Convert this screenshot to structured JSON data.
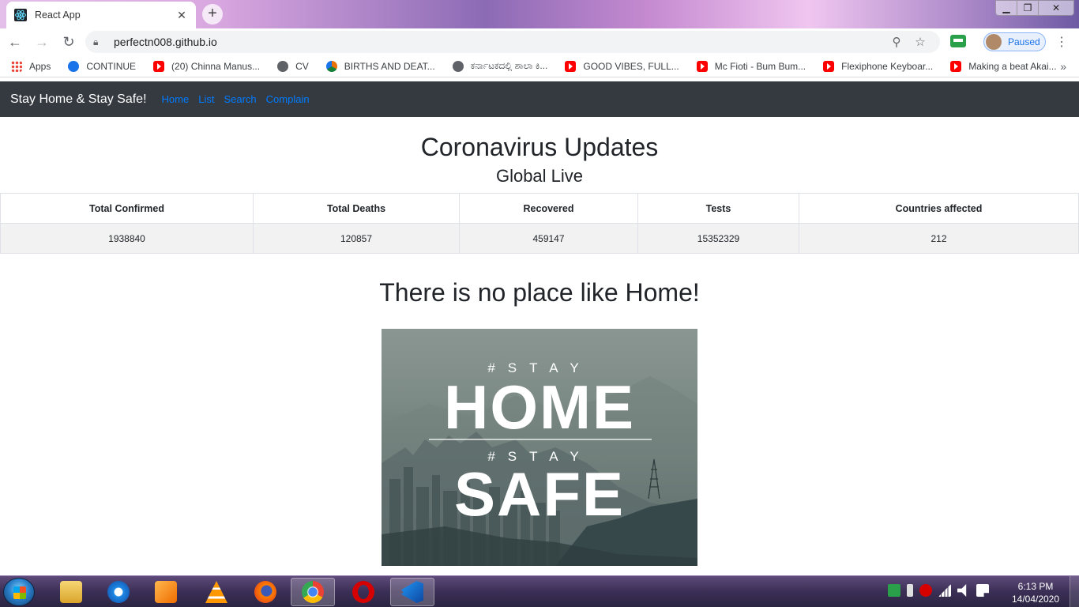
{
  "browser": {
    "tab_title": "React App",
    "tab_close": "✕",
    "new_tab": "+",
    "window_controls": {
      "minimize": "▁",
      "maximize": "❐",
      "close": "✕"
    },
    "nav": {
      "back": "←",
      "forward": "→",
      "reload": "↻"
    },
    "url": "perfectn008.github.io",
    "zoom_icon": "⚲",
    "star_icon": "☆",
    "profile_status": "Paused",
    "menu": "⋮",
    "bookmarks": [
      {
        "icon": "apps",
        "label": "Apps"
      },
      {
        "icon": "dl",
        "label": "CONTINUE"
      },
      {
        "icon": "yt",
        "label": "(20) Chinna Manus..."
      },
      {
        "icon": "globe",
        "label": "CV"
      },
      {
        "icon": "gov",
        "label": "BIRTHS AND DEAT..."
      },
      {
        "icon": "globe",
        "label": "ಕರ್ನಾಟಕದಲ್ಲಿ ಶಾಲಾ ಕಿ..."
      },
      {
        "icon": "yt",
        "label": "GOOD VIBES, FULL..."
      },
      {
        "icon": "yt",
        "label": "Mc Fioti - Bum Bum..."
      },
      {
        "icon": "yt",
        "label": "Flexiphone Keyboar..."
      },
      {
        "icon": "yt",
        "label": "Making a beat Akai..."
      }
    ],
    "bookmarks_more": "»"
  },
  "app": {
    "brand": "Stay Home & Stay Safe!",
    "links": [
      "Home",
      "List",
      "Search",
      "Complain"
    ],
    "title": "Coronavirus Updates",
    "subtitle": "Global Live",
    "table": {
      "headers": [
        "Total Confirmed",
        "Total Deaths",
        "Recovered",
        "Tests",
        "Countries affected"
      ],
      "row": [
        "1938840",
        "120857",
        "459147",
        "15352329",
        "212"
      ]
    },
    "tagline": "There is no place like Home!",
    "poster": {
      "line1": "#STAY",
      "line2": "HOME",
      "line3": "#STAY",
      "line4": "SAFE"
    }
  },
  "taskbar": {
    "apps": [
      "file-explorer",
      "internet-explorer",
      "media-player",
      "vlc",
      "firefox",
      "chrome",
      "opera",
      "vscode"
    ],
    "active_app": "chrome",
    "time": "6:13 PM",
    "date": "14/04/2020"
  },
  "colors": {
    "navbar_bg": "#343a40",
    "link": "#007bff",
    "row_stripe": "#f2f2f2"
  }
}
